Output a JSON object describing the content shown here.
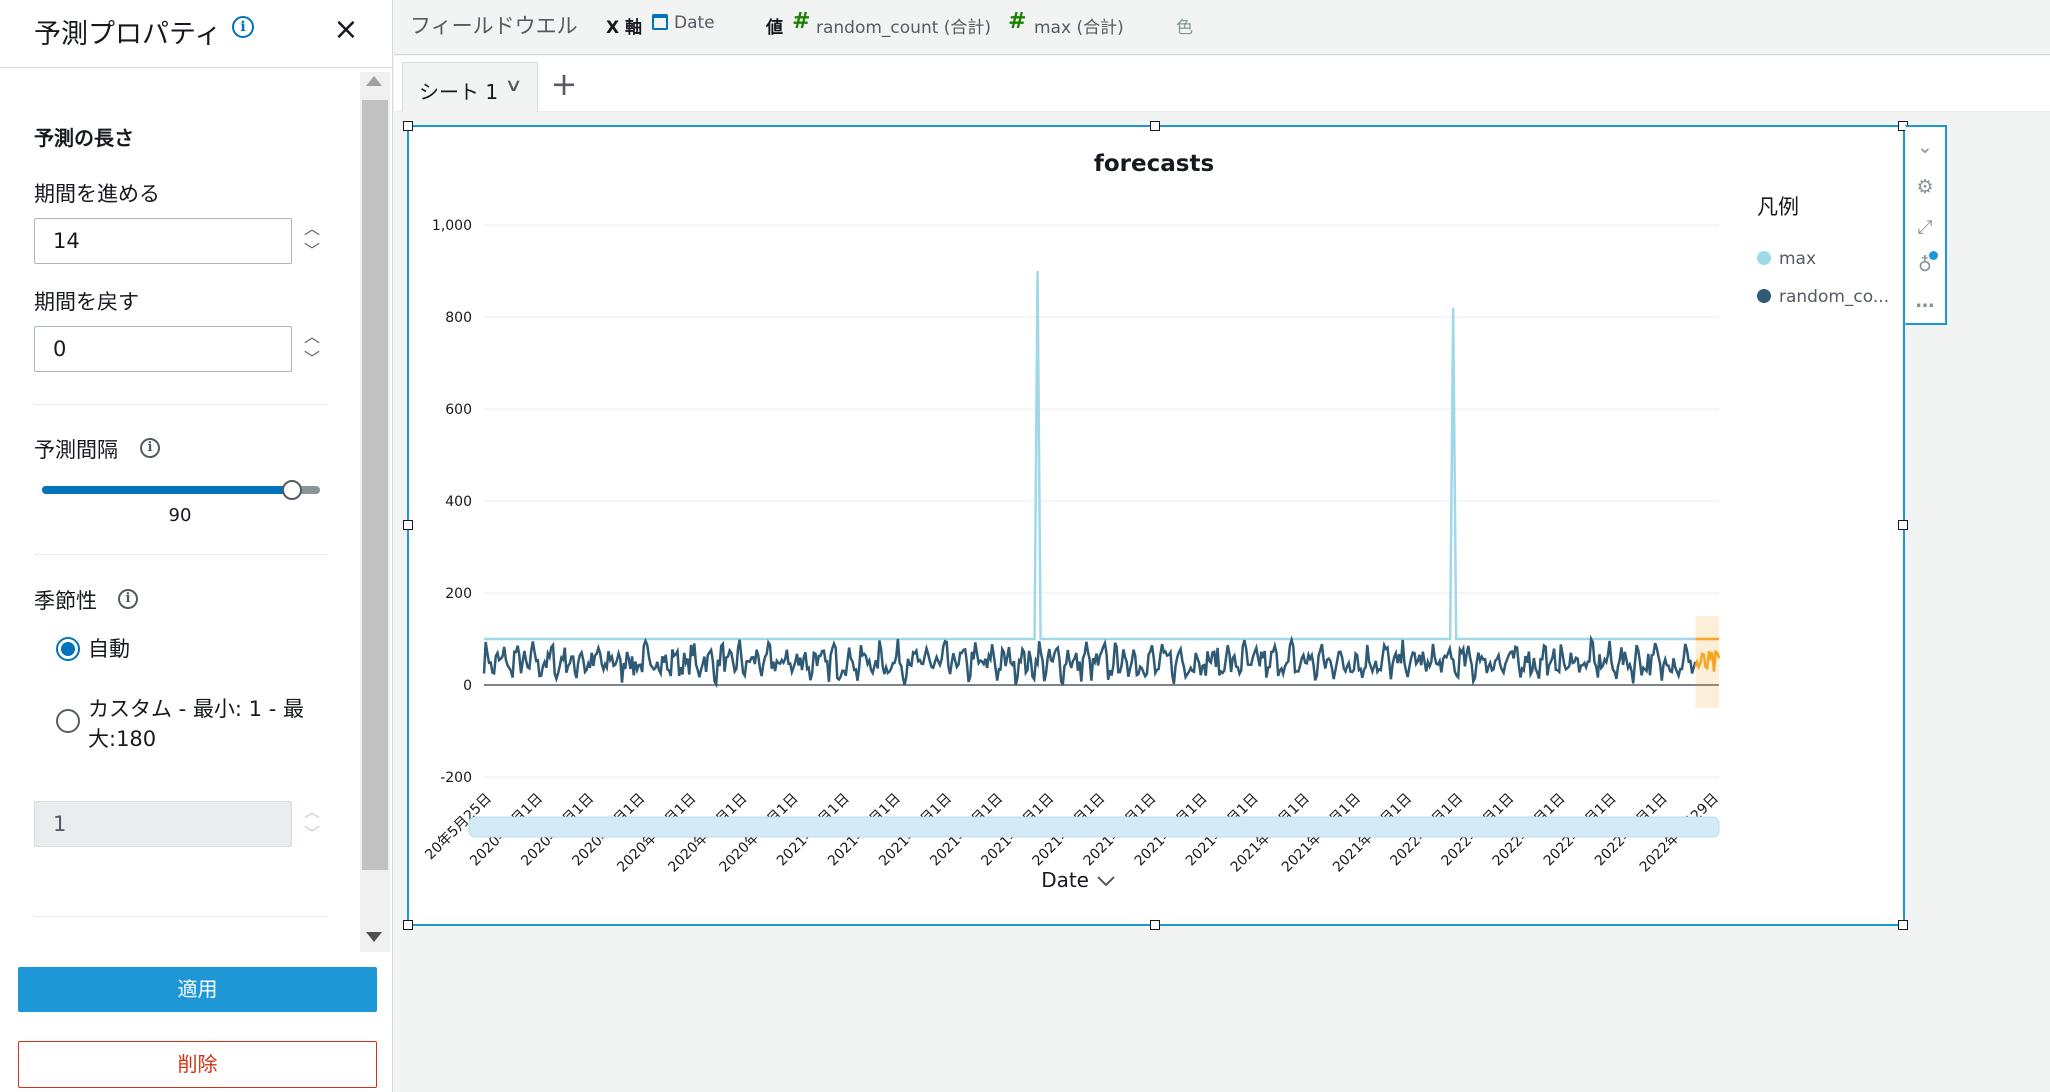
{
  "panel": {
    "title": "予測プロパティ",
    "info_glyph": "i",
    "close_glyph": "×",
    "forecast_length_title": "予測の長さ",
    "periods_forward_label": "期間を進める",
    "periods_forward_value": "14",
    "periods_backward_label": "期間を戻す",
    "periods_backward_value": "0",
    "prediction_interval_label": "予測間隔",
    "prediction_interval_value": 90,
    "prediction_interval_display": "90",
    "seasonality_label": "季節性",
    "seasonality_auto_label": "自動",
    "seasonality_custom_label": "カスタム - 最小: 1 - 最大:180",
    "seasonality_custom_value": "1",
    "apply_label": "適用",
    "delete_label": "削除"
  },
  "fieldwell": {
    "title": "フィールドウエル",
    "x_axis_label": "X 軸",
    "x_axis_field": "Date",
    "value_label": "値",
    "value_field_1": "random_count (合計)",
    "value_field_2": "max (合計)",
    "color_label": "色"
  },
  "tabs": {
    "sheet_label": "シート 1",
    "add_glyph": "+"
  },
  "chart": {
    "title": "forecasts",
    "legend_title": "凡例",
    "legend": [
      {
        "label": "max",
        "color": "#9fd8e8"
      },
      {
        "label": "random_co...",
        "color": "#2e5a75"
      }
    ],
    "xaxis_title": "Date"
  },
  "chart_data": {
    "type": "line",
    "title": "forecasts",
    "xlabel": "Date",
    "ylabel": "",
    "ylim": [
      -200,
      1000
    ],
    "y_ticks": [
      "1,000",
      "800",
      "600",
      "400",
      "200",
      "0",
      "-200"
    ],
    "x_ticks": [
      "20年5月25日",
      "2020年7月1日",
      "2020年8月1日",
      "2020年9月1日",
      "2020年10月1日",
      "2020年11月1日",
      "2020年12月1日",
      "2021年1月1日",
      "2021年2月1日",
      "2021年3月1日",
      "2021年4月1日",
      "2021年5月1日",
      "2021年6月1日",
      "2021年7月1日",
      "2021年8月1日",
      "2021年9月1日",
      "2021年10月1日",
      "2021年11月1日",
      "2021年12月1日",
      "2022年1月1日",
      "2022年2月1日",
      "2022年3月1日",
      "2022年4月1日",
      "2022年5月1日",
      "2022年5月29日"
    ],
    "series": [
      {
        "name": "max",
        "color": "#9fd8e8",
        "baseline": 100,
        "spikes": [
          {
            "date": "2021-04-19",
            "value": 900
          },
          {
            "date": "2021-12-22",
            "value": 820
          }
        ]
      },
      {
        "name": "random_co...",
        "color": "#2e5a75",
        "range": [
          0,
          100
        ]
      }
    ],
    "forecast_color": "#f5a623"
  }
}
